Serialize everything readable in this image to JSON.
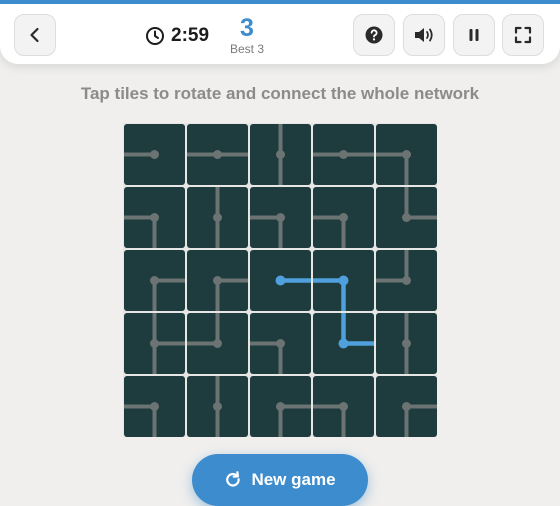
{
  "header": {
    "timer": "2:59",
    "score": "3",
    "best_label": "Best 3"
  },
  "instruction": "Tap tiles to rotate and connect the whole network",
  "new_game_label": "New game",
  "colors": {
    "accent": "#3d8ccd",
    "tile": "#1e3b3d",
    "pipe_inactive": "#6b7373",
    "pipe_active": "#4fa0dc"
  },
  "board": {
    "size": 5,
    "tiles": [
      [
        {
          "c": "W",
          "a": false
        },
        {
          "c": "WE",
          "a": false
        },
        {
          "c": "NS",
          "a": false
        },
        {
          "c": "WE",
          "a": false
        },
        {
          "c": "WS",
          "a": false
        }
      ],
      [
        {
          "c": "WS",
          "a": false
        },
        {
          "c": "NS",
          "a": false
        },
        {
          "c": "WS",
          "a": false
        },
        {
          "c": "WS",
          "a": false
        },
        {
          "c": "NE",
          "a": false
        }
      ],
      [
        {
          "c": "ES",
          "a": false
        },
        {
          "c": "ES",
          "a": false
        },
        {
          "c": "E",
          "a": true
        },
        {
          "c": "WS",
          "a": true
        },
        {
          "c": "NW",
          "a": false
        }
      ],
      [
        {
          "c": "NSE",
          "a": false
        },
        {
          "c": "NW",
          "a": false
        },
        {
          "c": "WS",
          "a": false
        },
        {
          "c": "NE",
          "a": true
        },
        {
          "c": "NS",
          "a": false
        }
      ],
      [
        {
          "c": "WS",
          "a": false
        },
        {
          "c": "NS",
          "a": false
        },
        {
          "c": "ES",
          "a": false
        },
        {
          "c": "WS",
          "a": false
        },
        {
          "c": "ES",
          "a": false
        }
      ]
    ]
  }
}
